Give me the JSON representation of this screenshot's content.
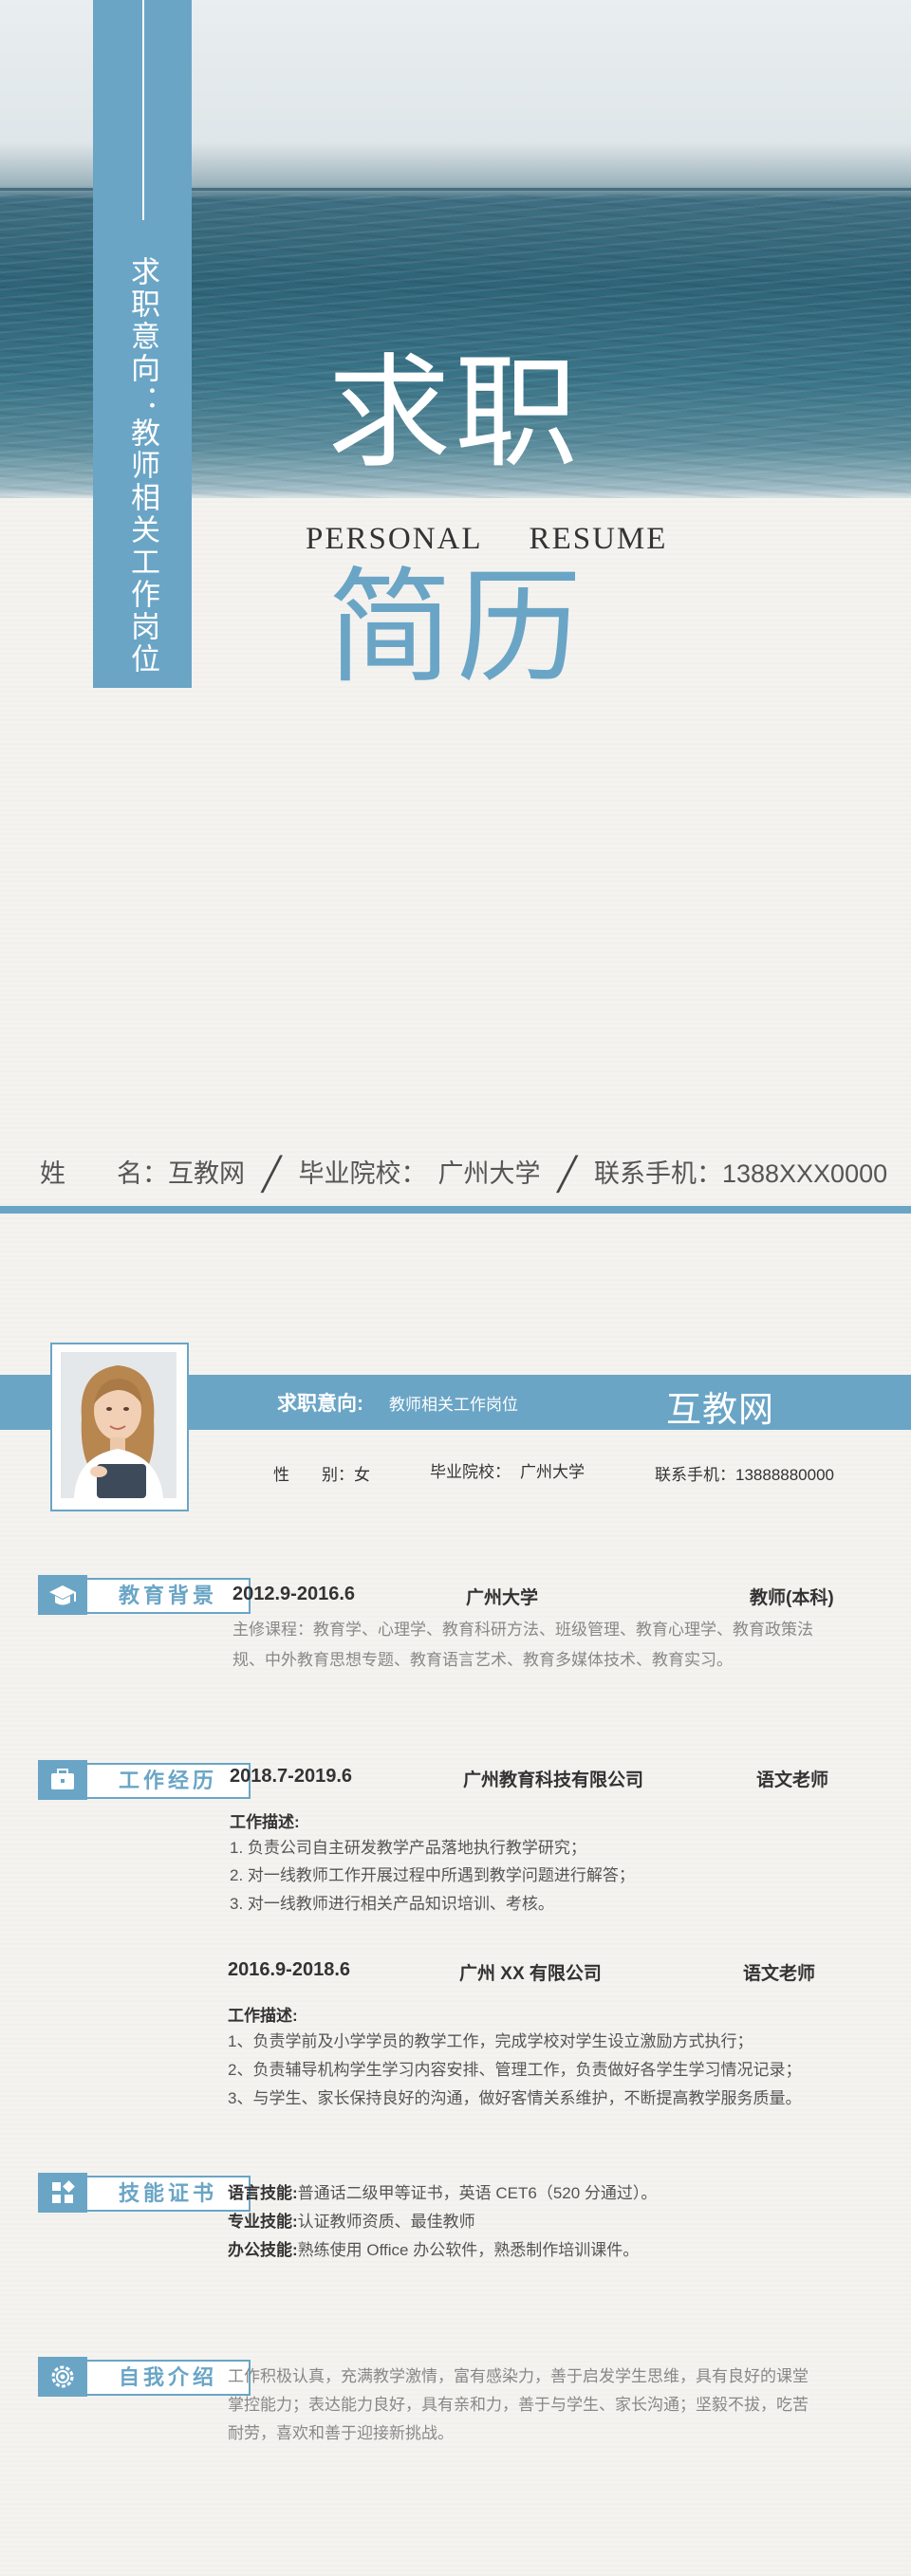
{
  "cover": {
    "vertical_text": "求职意向：教师相关工作岗位",
    "title_top": "求职",
    "title_en": "PERSONAL RESUME",
    "title_bottom": "简历",
    "info": {
      "name_label": "姓　　名：",
      "name": "互教网",
      "school_label": "毕业院校：",
      "school": "广州大学",
      "phone_label": "联系手机：",
      "phone": "1388XXX0000"
    },
    "accent_color": "#6aa5c6"
  },
  "header": {
    "intent_label": "求职意向:",
    "intent_value": "教师相关工作岗位",
    "name": "互教网",
    "gender_label": "性　　别：",
    "gender": "女",
    "school_label": "毕业院校：",
    "school": "广州大学",
    "phone_label": "联系手机：",
    "phone": "13888880000"
  },
  "education": {
    "title": "教育背景",
    "icon": "graduation-cap-icon",
    "period": "2012.9-2016.6",
    "school": "广州大学",
    "degree": "教师(本科)",
    "courses_line1": "主修课程：教育学、心理学、教育科研方法、班级管理、教育心理学、教育政策法",
    "courses_line2": "规、中外教育思想专题、教育语言艺术、教育多媒体技术、教育实习。"
  },
  "work": {
    "title": "工作经历",
    "icon": "briefcase-icon",
    "jobs": [
      {
        "period": "2018.7-2019.6",
        "company": "广州教育科技有限公司",
        "role": "语文老师",
        "desc_label": "工作描述:",
        "items": [
          "1.  负责公司自主研发教学产品落地执行教学研究；",
          "2.  对一线教师工作开展过程中所遇到教学问题进行解答；",
          "3.  对一线教师进行相关产品知识培训、考核。"
        ]
      },
      {
        "period": "2016.9-2018.6",
        "company": "广州 XX 有限公司",
        "role": "语文老师",
        "desc_label": "工作描述:",
        "items": [
          "1、负责学前及小学学员的教学工作，完成学校对学生设立激励方式执行；",
          "2、负责辅导机构学生学习内容安排、管理工作，负责做好各学生学习情况记录；",
          "3、与学生、家长保持良好的沟通，做好客情关系维护，不断提高教学服务质量。"
        ]
      }
    ]
  },
  "skills": {
    "title": "技能证书",
    "icon": "grid-icon",
    "items": [
      {
        "label": "语言技能:",
        "value": "普通话二级甲等证书，英语 CET6（520 分通过）。"
      },
      {
        "label": "专业技能:",
        "value": "认证教师资质、最佳教师"
      },
      {
        "label": "办公技能:",
        "value": "熟练使用 Office 办公软件，熟悉制作培训课件。"
      }
    ]
  },
  "about": {
    "title": "自我介绍",
    "icon": "gear-icon",
    "line1": "工作积极认真，充满教学激情，富有感染力，善于启发学生思维，具有良好的课堂",
    "line2": "掌控能力；表达能力良好，具有亲和力，善于与学生、家长沟通；坚毅不拔，吃苦",
    "line3": "耐劳，喜欢和善于迎接新挑战。"
  }
}
